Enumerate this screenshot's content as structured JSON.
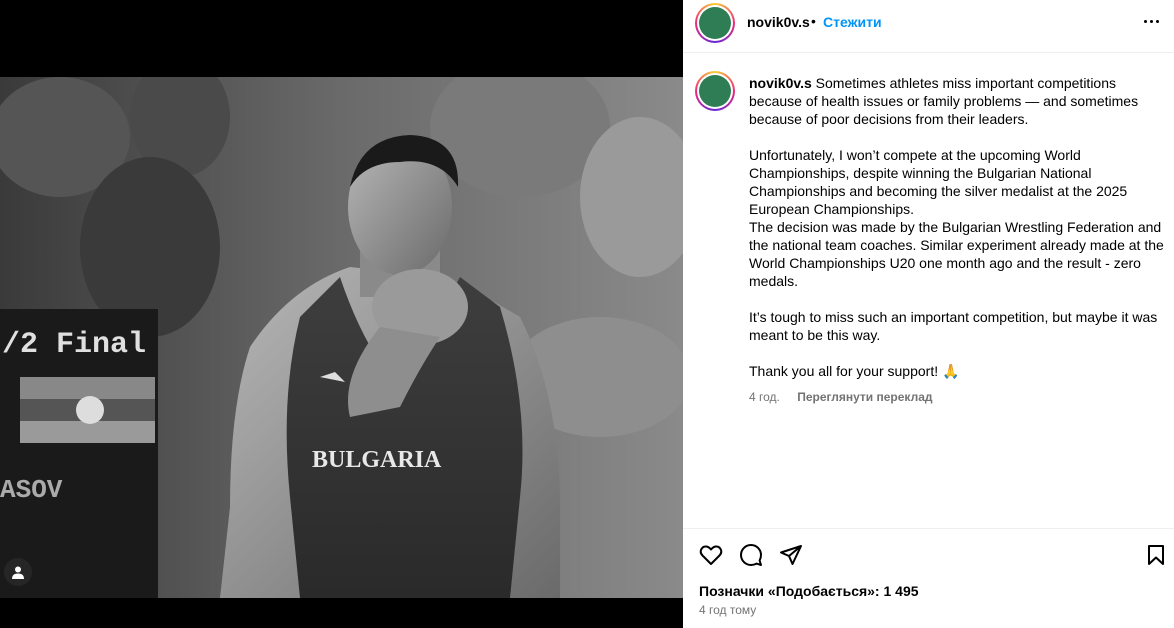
{
  "post": {
    "username": "novik0v.s",
    "follow_label": "Стежити",
    "separator": "•",
    "caption_paragraphs": [
      "Sometimes athletes miss important competitions because of health issues or family problems — and sometimes because of poor decisions from their leaders.",
      "Unfortunately, I won’t compete at the upcoming World Championships, despite winning the Bulgarian National Championships and becoming the silver medalist at the 2025 European Championships.\nThe decision was made by the Bulgarian Wrestling Federation and the national team coaches. Similar experiment already made at the World Championships U20 one month ago and the result - zero medals.",
      "It’s tough to miss such an important competition, but maybe it was meant to be this way.",
      "Thank you all for your support! 🙏"
    ],
    "comment_age": "4 год.",
    "translate_label": "Переглянути переклад",
    "likes_text": "Позначки «Подобається»: 1 495",
    "date_text": "4 год тому"
  },
  "photo": {
    "banner_text": "/2 Final",
    "singlet_text": "BULGARIA",
    "scoreboard_text": "ASOV"
  },
  "icons": {
    "like": "heart-icon",
    "comment": "comment-icon",
    "share": "share-icon",
    "save": "bookmark-icon",
    "more": "more-icon",
    "tag": "user-tag-icon"
  },
  "colors": {
    "link": "#0095f6",
    "muted": "#737373"
  }
}
